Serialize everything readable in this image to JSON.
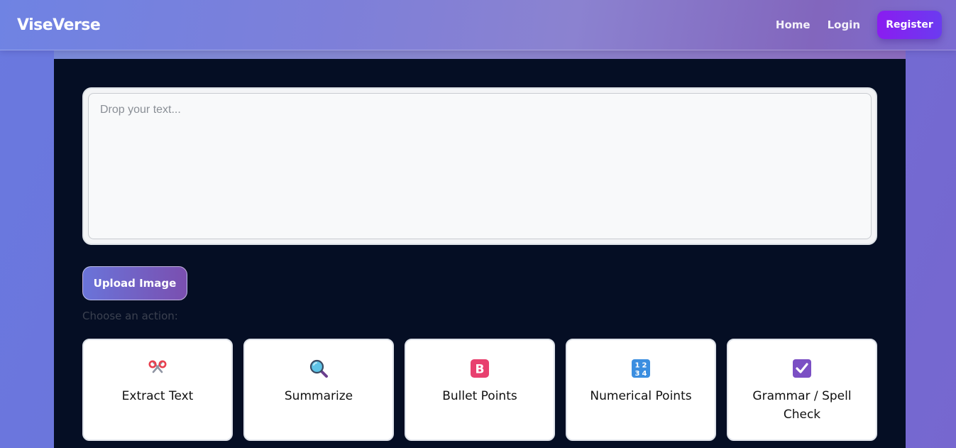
{
  "nav": {
    "brand": "ViseVerse",
    "links": [
      "Home",
      "Login"
    ],
    "register_label": "Register"
  },
  "editor": {
    "placeholder": "Drop your text..."
  },
  "upload": {
    "label": "Upload Image"
  },
  "actions": {
    "prompt": "Choose an action:",
    "items": [
      {
        "label": "Extract Text",
        "icon": "scissors-icon"
      },
      {
        "label": "Summarize",
        "icon": "magnifier-icon"
      },
      {
        "label": "Bullet Points",
        "icon": "letter-b-icon"
      },
      {
        "label": "Numerical Points",
        "icon": "numbers-1234-icon"
      },
      {
        "label": "Grammar / Spell Check",
        "icon": "checkbox-icon"
      }
    ]
  },
  "colors": {
    "accent": "#8a1cf0",
    "panel_bg": "#050e24",
    "card_bg": "#ffffff"
  }
}
